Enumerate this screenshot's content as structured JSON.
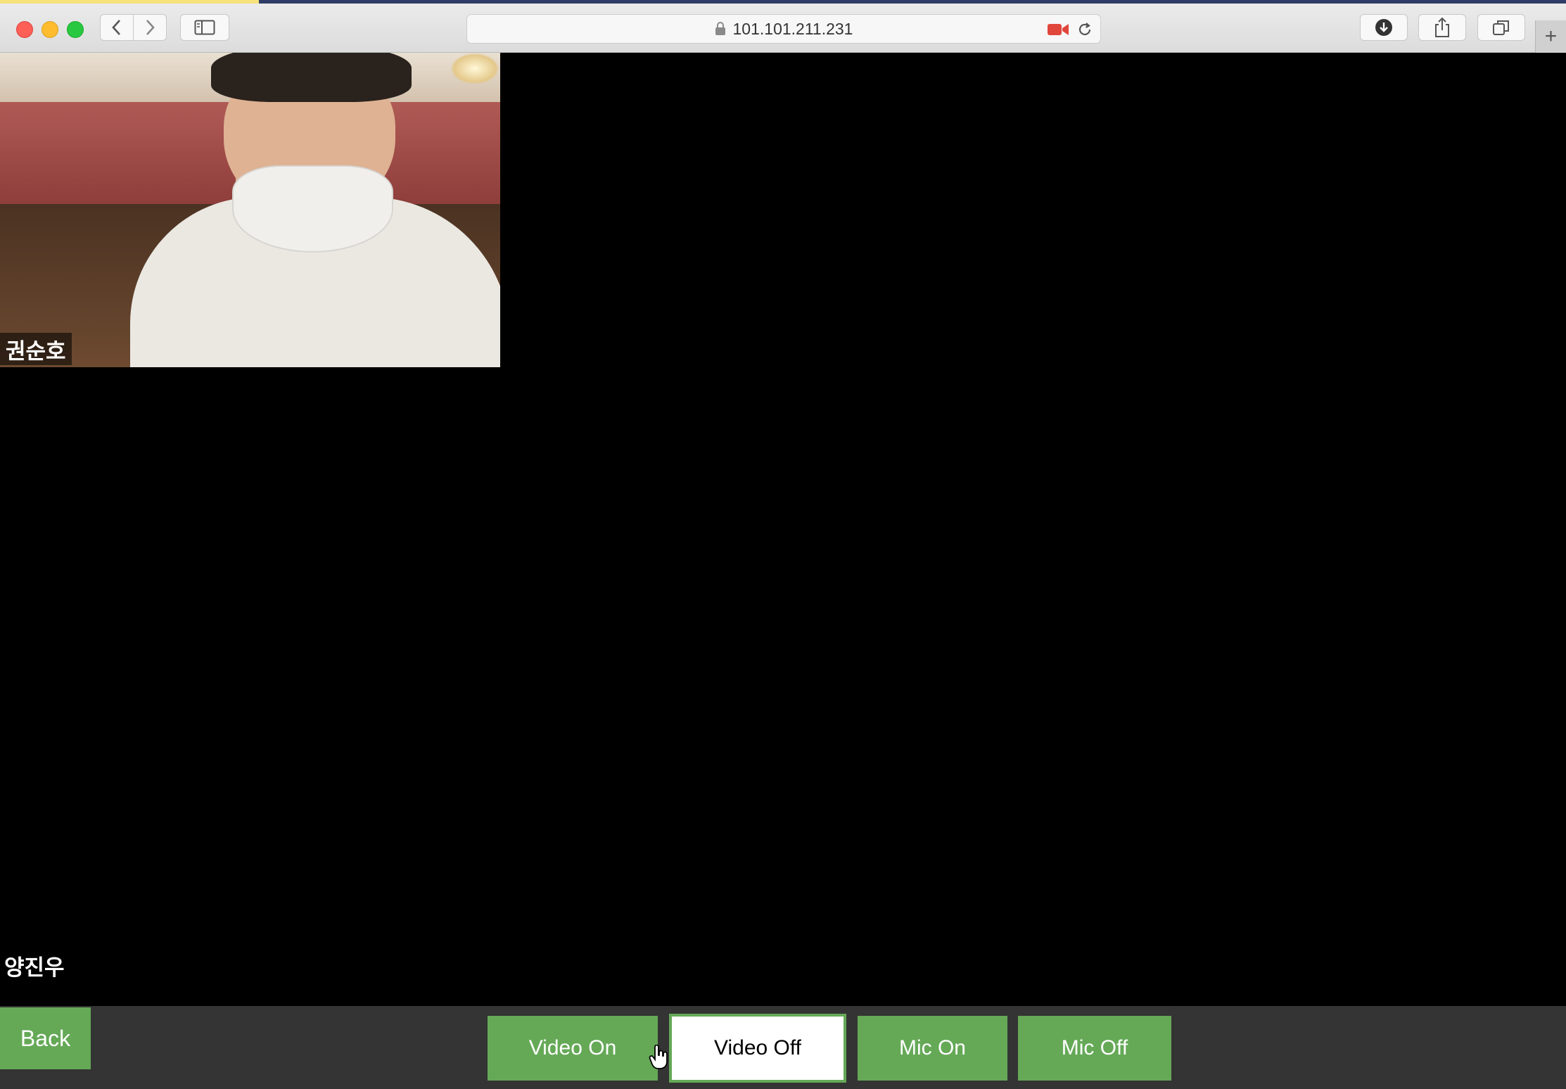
{
  "browser": {
    "url": "101.101.211.231",
    "new_tab_label": "+"
  },
  "call": {
    "remote_participant_name": "권순호",
    "local_participant_name": "양진우"
  },
  "controls": {
    "back_label": "Back",
    "video_on_label": "Video On",
    "video_off_label": "Video Off",
    "mic_on_label": "Mic On",
    "mic_off_label": "Mic Off",
    "accent_color": "#65a957"
  }
}
